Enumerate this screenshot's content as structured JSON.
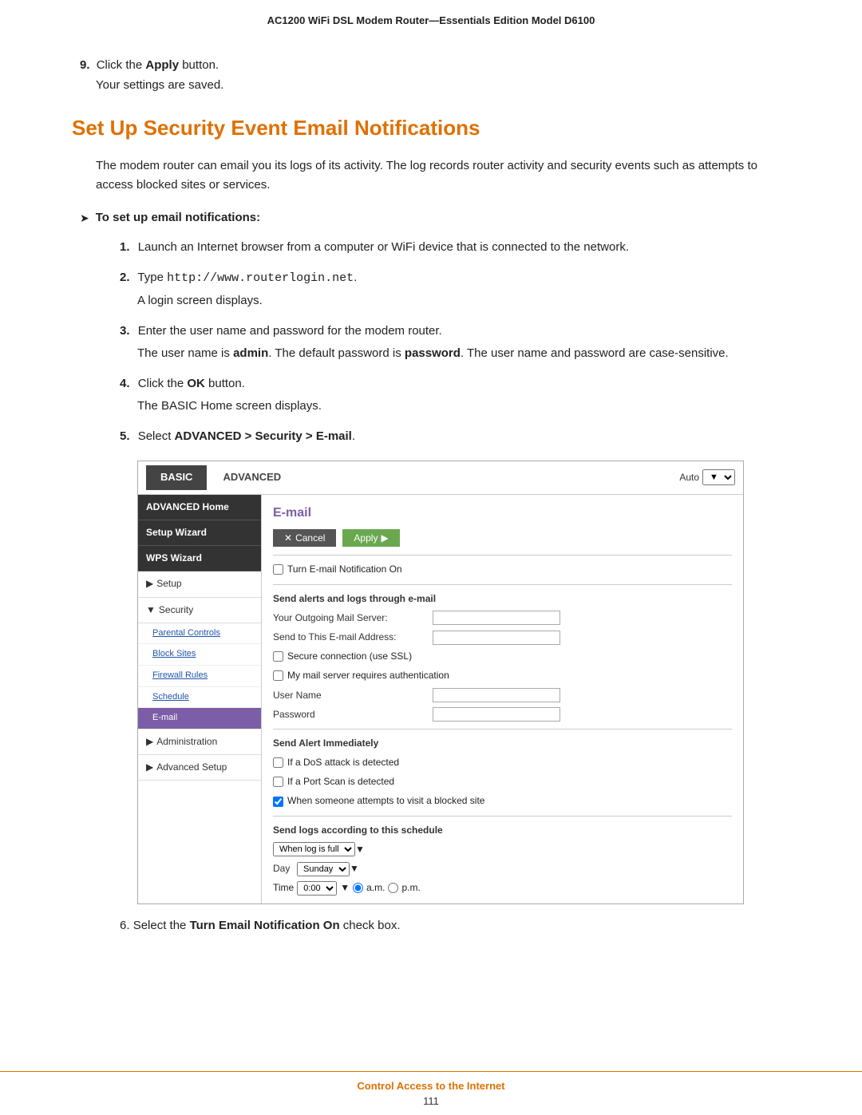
{
  "header": {
    "title": "AC1200 WiFi DSL Modem Router—Essentials Edition Model D6100"
  },
  "step9": {
    "text": "Click the ",
    "bold": "Apply",
    "suffix": " button."
  },
  "saved": {
    "text": "Your settings are saved."
  },
  "section": {
    "title": "Set Up Security Event Email Notifications"
  },
  "intro": {
    "text": "The modem router can email you its logs of its activity. The log records router activity and security events such as attempts to access blocked sites or services."
  },
  "bullet": {
    "label": "To set up email notifications:"
  },
  "steps": [
    {
      "num": "1.",
      "text": "Launch an Internet browser from a computer or WiFi device that is connected to the network."
    },
    {
      "num": "2.",
      "text": "Type ",
      "url": "http://www.routerlogin.net",
      "suffix": ".",
      "sub": "A login screen displays."
    },
    {
      "num": "3.",
      "text": "Enter the user name and password for the modem router.",
      "sub": "The user name is ",
      "sub_bold1": "admin",
      "sub_mid": ". The default password is ",
      "sub_bold2": "password",
      "sub_end": ". The user name and password are case-sensitive."
    },
    {
      "num": "4.",
      "text": "Click the ",
      "bold": "OK",
      "suffix": " button.",
      "sub": "The BASIC Home screen displays."
    },
    {
      "num": "5.",
      "text": "Select ",
      "bold": "ADVANCED > Security > E-mail",
      "suffix": "."
    }
  ],
  "step6": {
    "num": "6.",
    "text": "Select the ",
    "bold": "Turn Email Notification On",
    "suffix": " check box."
  },
  "ui": {
    "tabs": {
      "basic": "BASIC",
      "advanced": "ADVANCED"
    },
    "auto_label": "Auto",
    "sidebar": {
      "items": [
        {
          "label": "ADVANCED Home",
          "type": "dark"
        },
        {
          "label": "Setup Wizard",
          "type": "dark"
        },
        {
          "label": "WPS Wizard",
          "type": "dark"
        },
        {
          "label": "▶ Setup",
          "type": "arrow"
        },
        {
          "label": "▼ Security",
          "type": "arrow"
        },
        {
          "label": "Parental Controls",
          "type": "sub"
        },
        {
          "label": "Block Sites",
          "type": "sub"
        },
        {
          "label": "Firewall Rules",
          "type": "sub"
        },
        {
          "label": "Schedule",
          "type": "sub"
        },
        {
          "label": "E-mail",
          "type": "sub-active"
        },
        {
          "label": "▶ Administration",
          "type": "arrow"
        },
        {
          "label": "▶ Advanced Setup",
          "type": "arrow"
        }
      ]
    },
    "main": {
      "title": "E-mail",
      "cancel_btn": "Cancel",
      "apply_btn": "Apply",
      "checkbox1": "Turn E-mail Notification On",
      "section1_label": "Send alerts and logs through e-mail",
      "outgoing_label": "Your Outgoing Mail Server:",
      "send_to_label": "Send to This E-mail Address:",
      "checkbox2": "Secure connection (use SSL)",
      "checkbox3": "My mail server requires authentication",
      "username_label": "User Name",
      "password_label": "Password",
      "section2_label": "Send Alert Immediately",
      "alert1": "If a DoS attack is detected",
      "alert2": "If a Port Scan is detected",
      "alert3": "When someone attempts to visit a blocked site",
      "section3_label": "Send logs according to this schedule",
      "schedule_options": [
        "When log is full"
      ],
      "day_label": "Day",
      "day_value": "Sunday",
      "time_label": "Time",
      "time_value": "0:00",
      "am_label": "a.m.",
      "pm_label": "p.m."
    }
  },
  "footer": {
    "text": "Control Access to the Internet",
    "page": "111"
  }
}
